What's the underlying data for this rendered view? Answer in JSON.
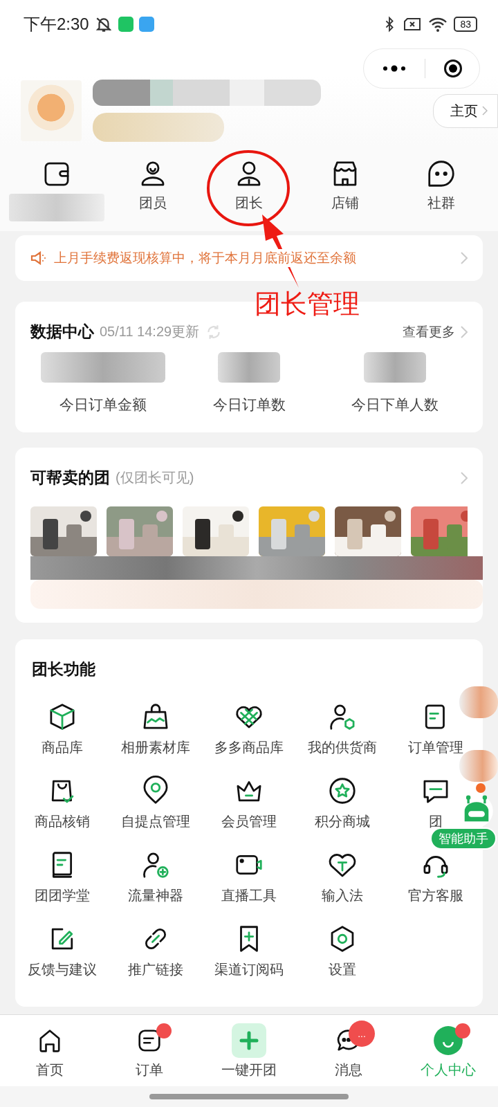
{
  "status_bar": {
    "time": "下午2:30",
    "battery": "83"
  },
  "header": {
    "home_button": "主页"
  },
  "quick_nav": [
    {
      "kind": "blurred"
    },
    {
      "kind": "labeled",
      "label": "团员"
    },
    {
      "kind": "labeled",
      "label": "团长"
    },
    {
      "kind": "labeled",
      "label": "店铺"
    },
    {
      "kind": "labeled",
      "label": "社群"
    }
  ],
  "annotation": {
    "label": "团长管理"
  },
  "notice": {
    "text": "上月手续费返现核算中，将于本月月底前返还至余额"
  },
  "data_center": {
    "title": "数据中心",
    "updated": "05/11 14:29更新",
    "more": "查看更多",
    "metrics": [
      "今日订单金额",
      "今日订单数",
      "今日下单人数"
    ]
  },
  "help_sell": {
    "title": "可帮卖的团",
    "note": "(仅团长可见)"
  },
  "functions": {
    "title": "团长功能",
    "items": [
      "商品库",
      "相册素材库",
      "多多商品库",
      "我的供货商",
      "订单管理",
      "商品核销",
      "自提点管理",
      "会员管理",
      "积分商城",
      "团",
      "团团学堂",
      "流量神器",
      "直播工具",
      "输入法",
      "官方客服",
      "反馈与建议",
      "推广链接",
      "渠道订阅码",
      "设置"
    ]
  },
  "assistant": {
    "label": "智能助手"
  },
  "tab_bar": [
    {
      "label": "首页",
      "selected": false,
      "dot": false
    },
    {
      "label": "订单",
      "selected": false,
      "dot": true
    },
    {
      "label": "一键开团",
      "selected": false,
      "dot": false
    },
    {
      "label": "消息",
      "selected": false,
      "dot": false,
      "badge": "..."
    },
    {
      "label": "个人中心",
      "selected": true,
      "dot": true
    }
  ]
}
